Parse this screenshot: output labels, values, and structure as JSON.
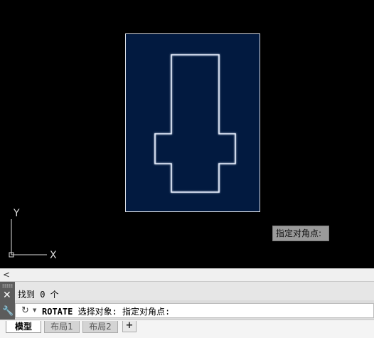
{
  "colors": {
    "canvas_bg": "#000000",
    "selection_fill": "#021a40",
    "geometry_stroke": "#ffffff"
  },
  "ucs": {
    "y_label": "Y",
    "x_label": "X"
  },
  "tooltip": {
    "text": "指定对角点:"
  },
  "hscroll": {
    "left_arrow": "<"
  },
  "command": {
    "history_text": "找到 0 个",
    "keyword": "ROTATE",
    "prompt": " 选择对象: 指定对角点:"
  },
  "icons": {
    "close": "close-icon",
    "settings": "wrench-icon",
    "command": "command-history-icon",
    "dropdown": "chevron-down-icon"
  },
  "tabs": [
    {
      "label": "模型",
      "active": true
    },
    {
      "label": "布局1",
      "active": false
    },
    {
      "label": "布局2",
      "active": false
    }
  ],
  "add_tab_label": "+"
}
